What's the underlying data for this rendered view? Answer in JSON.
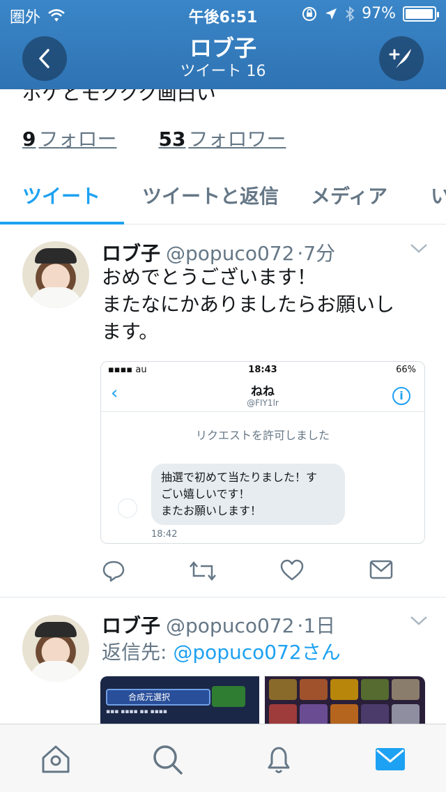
{
  "status_bar": {
    "carrier": "圏外",
    "time": "午後6:51",
    "battery": "97%",
    "battery_level": 0.97
  },
  "header": {
    "title": "ロブ子",
    "subtitle": "ツイート 16",
    "back_icon": "chevron-left-icon",
    "compose_icon": "compose-tweet-icon"
  },
  "profile": {
    "bio_cutoff": "ボケとモククク画白い",
    "following_count": "9",
    "following_label": "フォロー",
    "followers_count": "53",
    "followers_label": "フォロワー"
  },
  "tabs": [
    {
      "label": "ツイート",
      "active": true
    },
    {
      "label": "ツイートと返信",
      "active": false
    },
    {
      "label": "メディア",
      "active": false
    },
    {
      "label": "い",
      "active": false
    }
  ],
  "tweets": [
    {
      "name": "ロブ子",
      "handle": "@popuco072",
      "time": "·7分",
      "text_lines": [
        "おめでとうございます！",
        "またなにかありましたらお願いし",
        "ます。"
      ],
      "media": {
        "status_carrier": "au",
        "status_time": "18:43",
        "status_battery": "66%",
        "chat_name": "ねね",
        "chat_handle": "@FIY1lr",
        "request_text": "リクエストを許可しました",
        "bubble_lines": [
          "抽選で初めて当たりました！す",
          "ごい嬉しいです！",
          "またお願いします！"
        ],
        "message_time": "18:42",
        "info_icon": "info-icon"
      }
    },
    {
      "name": "ロブ子",
      "handle": "@popuco072",
      "time": "·1日",
      "reply_prefix": "返信先: ",
      "reply_to": "@popuco072さん",
      "media_left_label": "合成元選択"
    }
  ],
  "bottom_nav": [
    {
      "icon": "home-icon",
      "active": false
    },
    {
      "icon": "search-icon",
      "active": false
    },
    {
      "icon": "notifications-icon",
      "active": false
    },
    {
      "icon": "messages-icon",
      "active": true
    }
  ],
  "colors": {
    "header_blue": "#3a86c8",
    "accent": "#1da1f2",
    "muted": "#657786"
  }
}
